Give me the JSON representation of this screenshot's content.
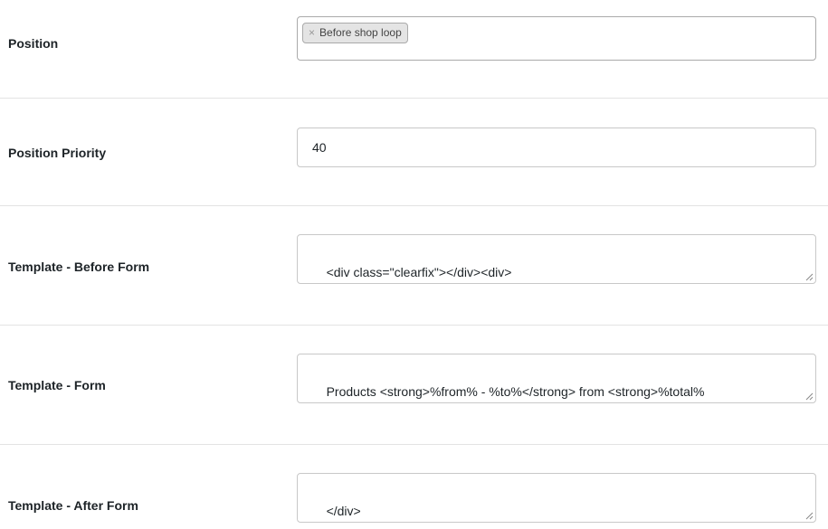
{
  "fields": {
    "position": {
      "label": "Position",
      "chip_remove": "×",
      "chip": "Before shop loop"
    },
    "priority": {
      "label": "Position Priority",
      "value": "40"
    },
    "before_form": {
      "label": "Template - Before Form",
      "value": "<div class=\"clearfix\"></div><div>"
    },
    "form": {
      "label": "Template - Form",
      "value": "Products <strong>%from% - %to%</strong> from <strong>%total%\n</strong>. Products on page %select_form%<br>"
    },
    "after_form": {
      "label": "Template - After Form",
      "value": "</div>"
    }
  },
  "icons": {
    "resize": "resize-grip-icon",
    "remove": "close-icon"
  },
  "colors": {
    "separator": "#e3e3e3",
    "border": "#c8c8c8",
    "chip_bg": "#e4e4e4",
    "text": "#1d2327"
  }
}
